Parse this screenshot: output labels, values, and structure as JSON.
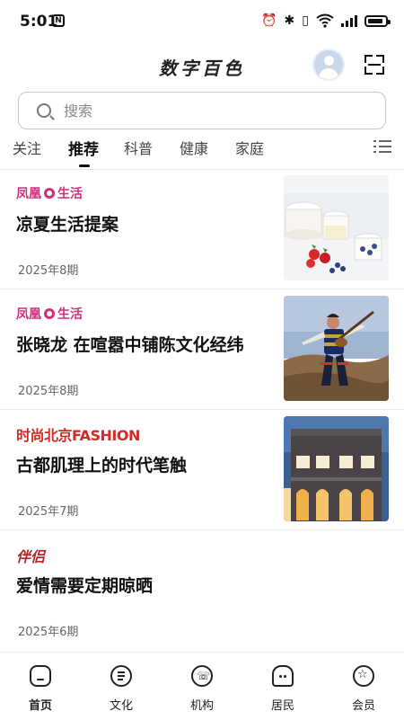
{
  "status": {
    "time": "5:01",
    "nfc": "N"
  },
  "app": {
    "title": "数字百色"
  },
  "search": {
    "placeholder": "搜索"
  },
  "tabs": [
    {
      "label": "关注"
    },
    {
      "label": "推荐",
      "active": true
    },
    {
      "label": "科普"
    },
    {
      "label": "健康"
    },
    {
      "label": "家庭"
    }
  ],
  "articles": [
    {
      "source_a": "凤凰",
      "source_b": "生活",
      "title": "凉夏生活提案",
      "date": "2025年8期"
    },
    {
      "source_a": "凤凰",
      "source_b": "生活",
      "title": "张晓龙  在喧嚣中铺陈文化经纬",
      "date": "2025年8期"
    },
    {
      "source": "时尚北京FASHION",
      "title": "古都肌理上的时代笔触",
      "date": "2025年7期"
    },
    {
      "source": "伴侣",
      "title": "爱情需要定期晾晒",
      "date": "2025年6期"
    }
  ],
  "bottom_nav": [
    {
      "label": "首页",
      "icon": "home-icon",
      "active": true
    },
    {
      "label": "文化",
      "icon": "culture-icon"
    },
    {
      "label": "机构",
      "icon": "institution-icon"
    },
    {
      "label": "居民",
      "icon": "resident-icon"
    },
    {
      "label": "会员",
      "icon": "member-icon"
    }
  ],
  "colors": {
    "accent": "#111111",
    "brand_pink": "#d22f7b",
    "brand_red": "#d42b25"
  }
}
